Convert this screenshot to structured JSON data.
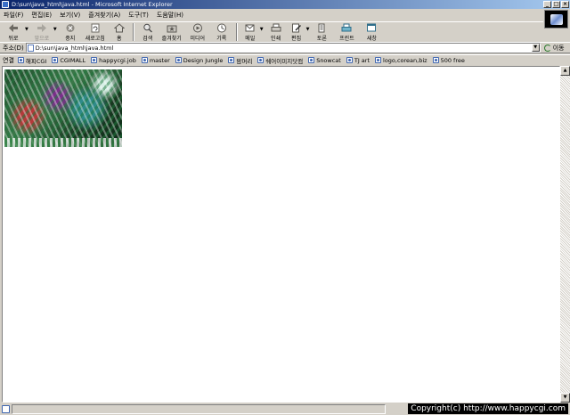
{
  "window": {
    "title": "D:\\sun\\java_html\\java.html - Microsoft Internet Explorer",
    "controls": [
      "_",
      "□",
      "×"
    ]
  },
  "menu": [
    "파일(F)",
    "편집(E)",
    "보기(V)",
    "즐겨찾기(A)",
    "도구(T)",
    "도움말(H)"
  ],
  "toolbar": {
    "back": "뒤로",
    "forward": "앞으로",
    "stop": "중지",
    "refresh": "새로고침",
    "home": "홈",
    "search": "검색",
    "favorites": "즐겨찾기",
    "media": "미디어",
    "history": "기록",
    "mail": "메일",
    "print": "인쇄",
    "edit": "편집",
    "discuss": "토론",
    "print2": "프린트",
    "messenger": "새창"
  },
  "address": {
    "label": "주소(D)",
    "value": "D:\\sun\\java_html\\java.html",
    "go_label": "이동"
  },
  "links": {
    "label": "연결",
    "items": [
      "해피CGI",
      "CGIMALL",
      "happycgi.job",
      "master",
      "Design Jungle",
      "맘머리",
      "쉐어이미지닷컴",
      "Snowcat",
      "TJ art",
      "logo,corean,biz",
      "500 free"
    ]
  },
  "status": {
    "copyright": "Copyright(c) http://www.happycgi.com"
  }
}
